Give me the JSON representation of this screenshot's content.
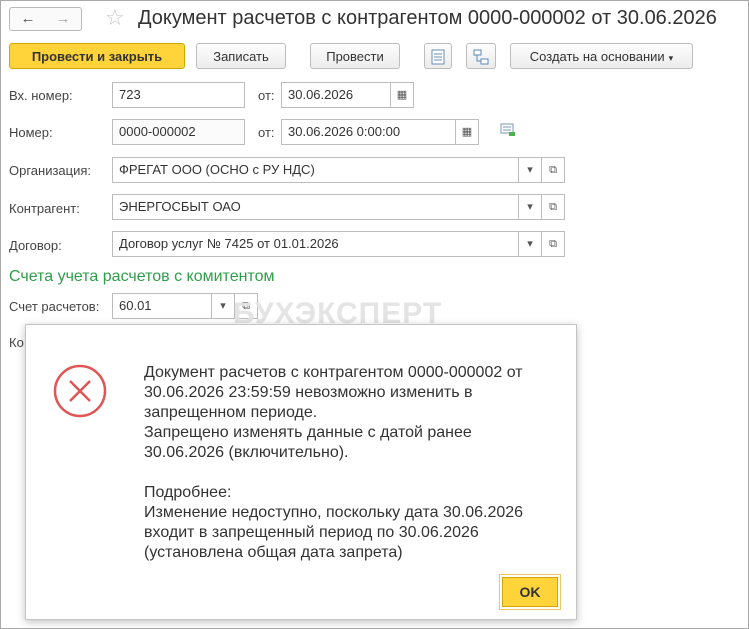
{
  "title_bar": {
    "back": "←",
    "forward": "→",
    "star": "☆",
    "title": "Документ расчетов с контрагентом 0000-000002 от 30.06.2026"
  },
  "toolbar": {
    "post_close": "Провести и закрыть",
    "save": "Записать",
    "post": "Провести",
    "create_based": "Создать на основании",
    "dropdown_caret": "▾",
    "icons": [
      "list-icon",
      "structure-icon"
    ]
  },
  "form": {
    "in_number": {
      "label": "Вх. номер:",
      "value": "723",
      "date_label": "от:",
      "date": "30.06.2026"
    },
    "number": {
      "label": "Номер:",
      "value": "0000-000002",
      "date_label": "от:",
      "date": "30.06.2026  0:00:00"
    },
    "organization": {
      "label": "Организация:",
      "value": "ФРЕГАТ ООО (ОСНО с РУ НДС)"
    },
    "counterparty": {
      "label": "Контрагент:",
      "value": "ЭНЕРГОСБЫТ ОАО"
    },
    "contract": {
      "label": "Договор:",
      "value": "Договор услуг № 7425 от 01.01.2026"
    },
    "section_title": "Счета учета расчетов с комитентом",
    "account": {
      "label": "Счет расчетов:",
      "value": "60.01"
    },
    "clipped_label": "Ко"
  },
  "watermark": "БУХЭКСПЕРТ",
  "dialog": {
    "lines": [
      "Документ расчетов с контрагентом 0000-000002 от",
      "30.06.2026 23:59:59 невозможно изменить в",
      "запрещенном периоде.",
      "Запрещено изменять данные с датой ранее",
      "30.06.2026 (включительно).",
      "",
      "Подробнее:",
      "Изменение недоступно, поскольку дата 30.06.2026",
      "входит в запрещенный период по 30.06.2026",
      "(установлена общая дата запрета)"
    ],
    "ok": "OK"
  },
  "colors": {
    "accent_yellow": "#ffd33a",
    "section_green": "#2f9d4a",
    "error_red": "#e05555"
  }
}
